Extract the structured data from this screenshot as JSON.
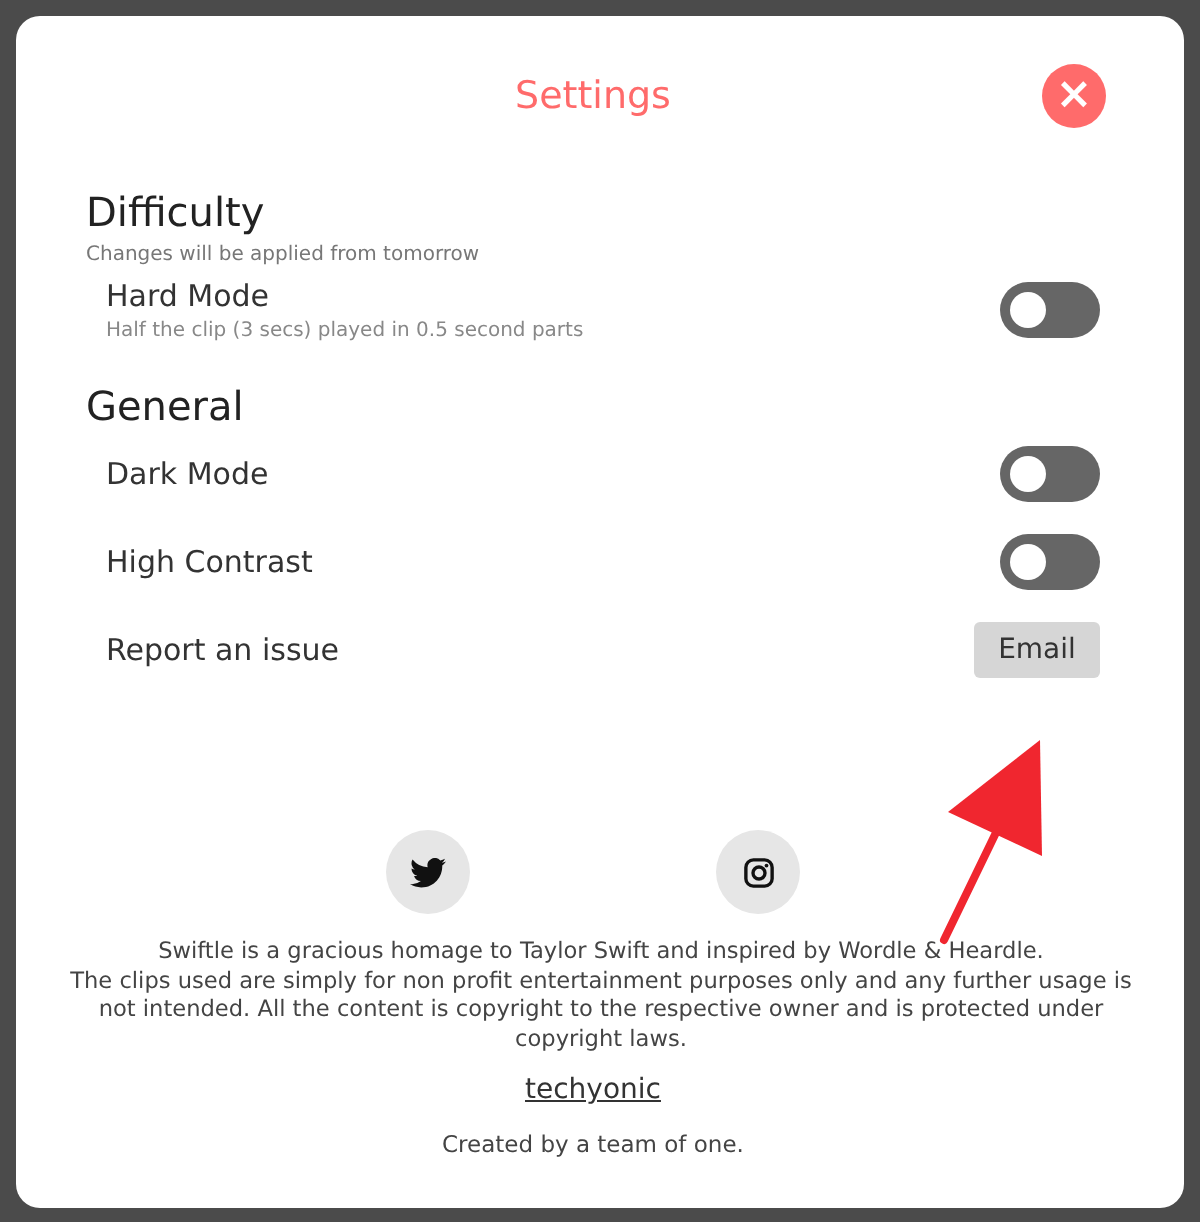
{
  "dialog": {
    "title": "Settings",
    "close_icon": "×"
  },
  "sections": [
    {
      "heading": "Difficulty",
      "note": "Changes will be applied from tomorrow",
      "rows": [
        {
          "kind": "toggle",
          "label": "Hard Mode",
          "description": "Half the clip (3 secs) played in 0.5 second parts",
          "on": false
        }
      ]
    },
    {
      "heading": "General",
      "rows": [
        {
          "kind": "toggle",
          "label": "Dark Mode",
          "on": false
        },
        {
          "kind": "toggle",
          "label": "High Contrast",
          "on": false
        },
        {
          "kind": "button",
          "label": "Report an issue",
          "button": "Email"
        }
      ]
    }
  ],
  "social": [
    {
      "kind": "twitter"
    },
    {
      "kind": "instagram"
    }
  ],
  "about": [
    "Swiftle is a gracious homage to Taylor Swift and inspired by Wordle & Heardle.",
    "The clips used are simply for non profit entertainment purposes only and any further usage is not intended. All the content is copyright to the respective owner and is protected under copyright laws."
  ],
  "link": "techyonic",
  "credit": "Created by a team of one.",
  "annotation": {
    "kind": "arrow"
  }
}
